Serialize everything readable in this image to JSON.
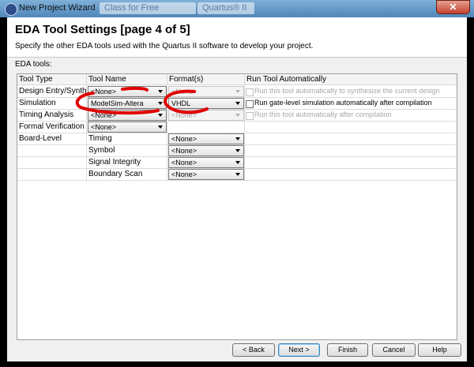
{
  "window": {
    "title": "New Project Wizard",
    "ghost_tabs": [
      "Class for Free",
      "Quartus® II"
    ],
    "close_label": "✕"
  },
  "page": {
    "title": "EDA Tool Settings [page 4 of 5]",
    "subtitle": "Specify the other EDA tools used with the Quartus II software to develop your project.",
    "section_label": "EDA tools:"
  },
  "table": {
    "headers": [
      "Tool Type",
      "Tool Name",
      "Format(s)",
      "Run Tool Automatically"
    ],
    "rows": [
      {
        "type": "Design Entry/Synthesis",
        "tool": "<None>",
        "format": "<None>",
        "run": "Run this tool automatically to synthesize the current design"
      },
      {
        "type": "Simulation",
        "tool": "ModelSim-Altera",
        "format": "VHDL",
        "run": "Run gate-level simulation automatically after compilation"
      },
      {
        "type": "Timing Analysis",
        "tool": "<None>",
        "format": "<None>",
        "run": "Run this tool automatically after compilation"
      },
      {
        "type": "Formal Verification",
        "tool": "<None>"
      },
      {
        "type": "Board-Level",
        "tool": "Timing",
        "format": "<None>"
      },
      {
        "type": "",
        "tool": "Symbol",
        "format": "<None>"
      },
      {
        "type": "",
        "tool": "Signal Integrity",
        "format": "<None>"
      },
      {
        "type": "",
        "tool": "Boundary Scan",
        "format": "<None>"
      }
    ]
  },
  "buttons": {
    "back": "< Back",
    "next": "Next >",
    "finish": "Finish",
    "cancel": "Cancel",
    "help": "Help"
  },
  "icons": {
    "app": "quartus-app-icon",
    "dropdown": "chevron-down-icon"
  },
  "colors": {
    "annotation": "#e00000",
    "titlebar": "#5b90c2",
    "close": "#c44232"
  }
}
